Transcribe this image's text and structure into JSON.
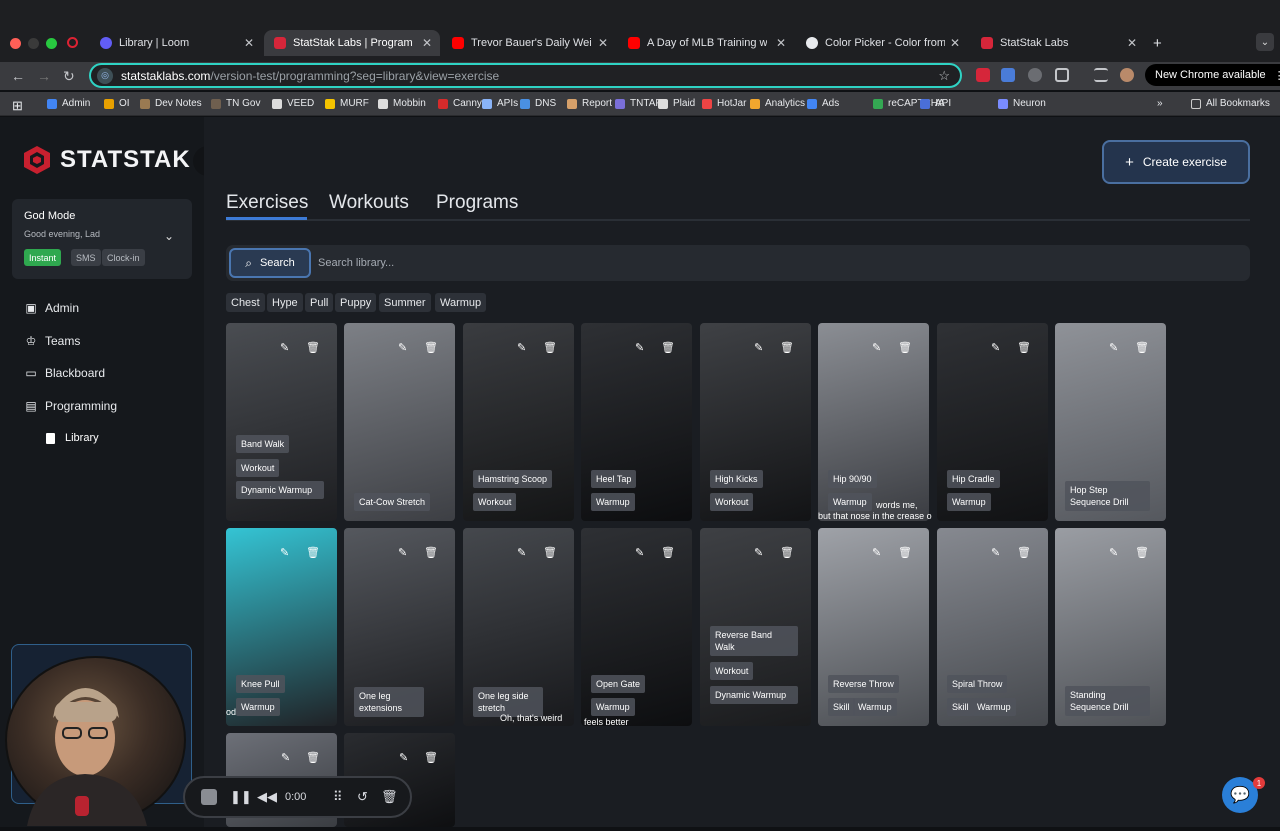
{
  "browser": {
    "tabs": [
      {
        "label": "Library | Loom",
        "color": "#625df5"
      },
      {
        "label": "StatStak Labs | Programmi",
        "color": "#d6263a"
      },
      {
        "label": "Trevor Bauer's Daily Weighted",
        "color": "#ff0000"
      },
      {
        "label": "A Day of MLB Training with Ju",
        "color": "#ff0000"
      },
      {
        "label": "Color Picker - Color from Ima",
        "color": "#e8eaed"
      },
      {
        "label": "StatStak Labs",
        "color": "#d6263a"
      }
    ],
    "url_host": "statstaklabs.com",
    "url_path": "/version-test/programming?seg=library&view=exercise",
    "new_chrome": "New Chrome available",
    "bookmarks": [
      "Admin",
      "OI",
      "Dev Notes",
      "TN Gov",
      "VEED",
      "MURF",
      "Mobbin",
      "Canny",
      "APIs",
      "DNS",
      "Report",
      "TNTAP",
      "Plaid",
      "HotJar",
      "Analytics",
      "Ads",
      "reCAPTCHA",
      "API",
      "Neuron"
    ],
    "all_bookmarks": "All Bookmarks"
  },
  "sidebar": {
    "brand": "STATSTAK",
    "mode_title": "God Mode",
    "greeting": "Good evening, Lad",
    "pills": [
      "Instant",
      "SMS",
      "Clock-in"
    ],
    "nav": [
      "Admin",
      "Teams",
      "Blackboard",
      "Programming"
    ],
    "sub_nav": "Library"
  },
  "main": {
    "create_label": "Create exercise",
    "tabs": [
      "Exercises",
      "Workouts",
      "Programs"
    ],
    "search_label": "Search",
    "search_placeholder": "Search library...",
    "filters": [
      "Chest",
      "Hype",
      "Pull",
      "Puppy",
      "Summer",
      "Warmup"
    ]
  },
  "exercises": [
    {
      "name": "Band Walk",
      "tags": [
        "Workout",
        "Dynamic Warmup"
      ]
    },
    {
      "name": "Cat-Cow Stretch",
      "tags": []
    },
    {
      "name": "Hamstring Scoop",
      "tags": [
        "Workout"
      ]
    },
    {
      "name": "Heel Tap",
      "tags": [
        "Warmup"
      ]
    },
    {
      "name": "High Kicks",
      "tags": [
        "Workout"
      ]
    },
    {
      "name": "Hip 90/90",
      "tags": [
        "Warmup"
      ]
    },
    {
      "name": "Hip Cradle",
      "tags": [
        "Warmup"
      ]
    },
    {
      "name": "Hop Step Sequence Drill",
      "tags": []
    },
    {
      "name": "Knee Pull",
      "tags": [
        "Warmup"
      ]
    },
    {
      "name": "One leg extensions",
      "tags": []
    },
    {
      "name": "One leg side stretch",
      "tags": []
    },
    {
      "name": "Open Gate",
      "tags": [
        "Warmup"
      ]
    },
    {
      "name": "Reverse Band Walk",
      "tags": [
        "Workout",
        "Dynamic Warmup"
      ]
    },
    {
      "name": "Reverse Throw",
      "tags": [
        "Skill",
        "Warmup"
      ]
    },
    {
      "name": "Spiral Throw",
      "tags": [
        "Skill",
        "Warmup"
      ]
    },
    {
      "name": "Standing Sequence Drill",
      "tags": []
    }
  ],
  "captions": {
    "c1": "words me,",
    "c2": "but that nose in the crease o",
    "c3": "od",
    "c4": "Oh, that's weird",
    "c5": "feels better"
  },
  "player": {
    "time": "0:00"
  },
  "chat_badge": "1"
}
